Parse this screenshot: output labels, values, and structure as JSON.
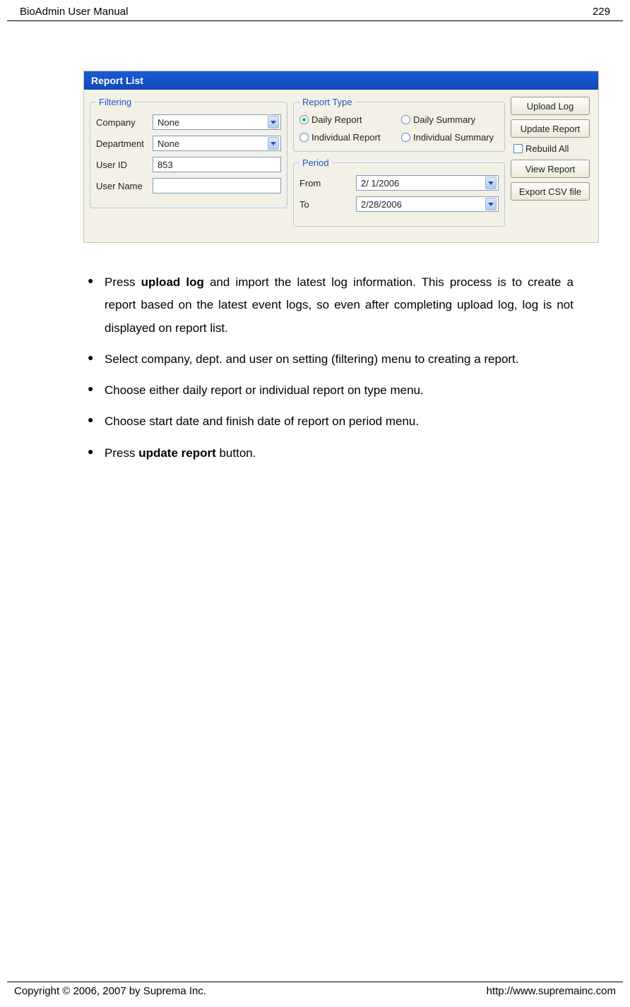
{
  "header": {
    "title": "BioAdmin User Manual",
    "page_number": "229"
  },
  "screenshot": {
    "titlebar": "Report List",
    "filtering": {
      "legend": "Filtering",
      "company_label": "Company",
      "company_value": "None",
      "department_label": "Department",
      "department_value": "None",
      "userid_label": "User ID",
      "userid_value": "853",
      "username_label": "User Name",
      "username_value": ""
    },
    "report_type": {
      "legend": "Report Type",
      "options": [
        "Daily Report",
        "Daily Summary",
        "Individual Report",
        "Individual Summary"
      ],
      "selected": "Daily Report"
    },
    "period": {
      "legend": "Period",
      "from_label": "From",
      "from_value": "2/  1/2006",
      "to_label": "To",
      "to_value": "2/28/2006"
    },
    "buttons": {
      "upload_log": "Upload Log",
      "update_report": "Update Report",
      "rebuild_all": "Rebuild All",
      "view_report": "View Report",
      "export_csv": "Export CSV file"
    }
  },
  "bullets": {
    "b1_pre": "Press ",
    "b1_bold": "upload log",
    "b1_post": " and import the latest log information. This process is to create a report based on the latest event logs, so even after completing upload log, log is not displayed on report list.",
    "b2": "Select company, dept. and user on setting (filtering) menu to creating a report.",
    "b3": "Choose either daily report or individual report on type menu.",
    "b4": "Choose start date and finish date of report on period menu.",
    "b5_pre": "Press ",
    "b5_bold": "update report",
    "b5_post": " button."
  },
  "footer": {
    "copyright": "Copyright © 2006, 2007 by Suprema Inc.",
    "url": "http://www.supremainc.com"
  }
}
